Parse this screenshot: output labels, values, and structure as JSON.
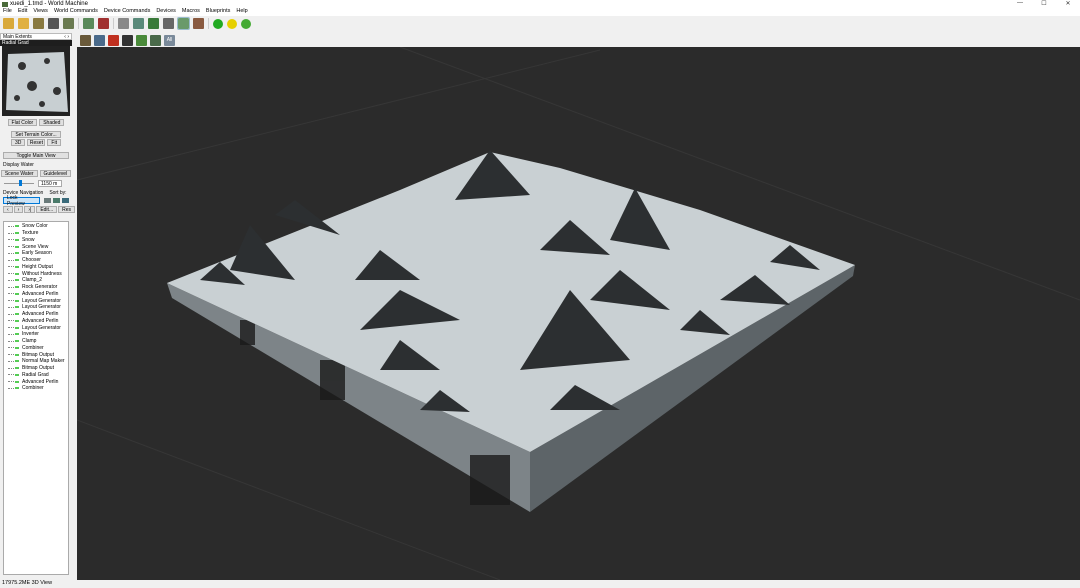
{
  "window": {
    "title": "xuedi_1.tmd - World Machine",
    "controls": [
      "—",
      "☐",
      "✕"
    ]
  },
  "menu": [
    "File",
    "Edit",
    "Views",
    "World Commands",
    "Device Commands",
    "Devices",
    "Macros",
    "Blueprints",
    "Help"
  ],
  "toolbar": {
    "icons": [
      "new-icon",
      "open-icon",
      "wizard-icon",
      "save-icon",
      "export-icon",
      "terrain-icon",
      "build-icon",
      "device-icon",
      "layout-icon",
      "grid-icon",
      "render-icon",
      "view3d-icon",
      "texture-icon"
    ],
    "balls": [
      "#22aa22",
      "#e6d000",
      "#44aa33"
    ]
  },
  "left": {
    "header": "Main Extents",
    "subheader": "Radial Grad",
    "flat_color": "Flat Color",
    "shaded": "Shaded",
    "set_terrain_color": "Set Terrain Color...",
    "btn_3d": "3D",
    "reset": "Reset",
    "fit": "Fit",
    "toggle_main_view": "Toggle Main View",
    "display_water": "Display Water",
    "scene_water": "Scene Water",
    "guidelevel": "Guidelevel",
    "water_level": "1150 m",
    "slider_fraction": 0.5,
    "device_navigation": "Device Navigation",
    "sort_by": "Sort by:",
    "lock_preview": "Lock Preview",
    "edit": "Edit...",
    "res": "Res",
    "devices": [
      "Snow Color",
      "Texture",
      "Snow",
      "Scene View",
      "Early Season",
      "Chooser",
      "Height Output",
      "Without Hardness",
      "Clamp_2",
      "Rock Generator",
      "Advanced Perlin",
      "Layout Generator",
      "Layout Generator",
      "Advanced Perlin",
      "Advanced Perlin",
      "Layout Generator",
      "Inverter",
      "Clamp",
      "Combiner",
      "Bitmap Output",
      "Normal Map Maker",
      "Bitmap Output",
      "Radial Grad",
      "Advanced Perlin",
      "Combiner"
    ]
  },
  "view_toolbar": {
    "all_label": "All"
  },
  "status": "17975.2ME 3D View"
}
